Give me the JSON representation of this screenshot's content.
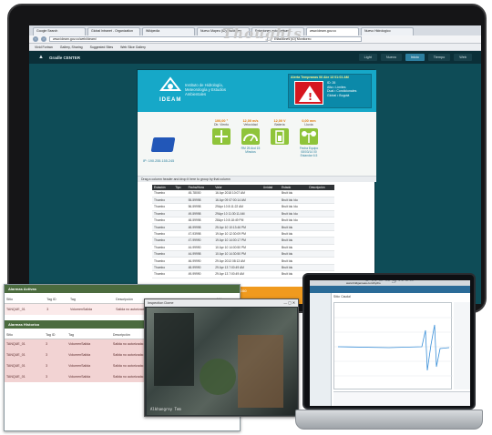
{
  "monitor": {
    "watermark": "Thoughts",
    "tabs": [
      "Google Search",
      "Global Intranet - Organization",
      "Wikipedia",
      "Nuevo Mapeo (ID) Monitoreo",
      "Estaciones automaticas",
      "www.ideam.gov.co",
      "Nuevo Hidrologico"
    ],
    "url": "www.ideam.gov.co/web/ideam/",
    "url2": "Estaciones (ID) Monitoreo",
    "bookmarks": [
      "Vivid Fortran",
      "Gallery, Sharing",
      "Suggested Sites",
      "Web Slice Gallery"
    ],
    "app": {
      "title": "Gradle CENTER",
      "nav": [
        "Light",
        "Nuevo",
        "Inicio",
        "Tiempo",
        "Web"
      ],
      "selected_nav": "Inicio"
    },
    "brand": {
      "org_text": "Instituto de Hidrología, Meteorología y Estudios Ambientales",
      "short": "IDEAM"
    },
    "alert": {
      "title": "Alerta Tempranas 06 Abr 13 01:01 AM",
      "lines": [
        "ID: 26",
        "Alta • Límites",
        "Dual • Condicionales",
        "Global • Bogotá"
      ]
    },
    "device_label": "IP: 190.255.155.245",
    "metrics": [
      {
        "value": "100,00 °",
        "label": "Dir. Viento",
        "sub": ""
      },
      {
        "value": "12,00 m/s",
        "label": "Velocidad",
        "sub": "RM 25 Avd 15 Minutos"
      },
      {
        "value": "12,00 V",
        "label": "Batería",
        "sub": ""
      },
      {
        "value": "0,00 mm",
        "label": "Lluvia",
        "sub": "Fecha Equipo 08/03/14 00 Estandar 6.5"
      }
    ],
    "table": {
      "title": "Drag a column header and drop it here to group by that column",
      "columns": [
        "Estación",
        "Tipo",
        "Fecha/Hora",
        "Valor",
        "Unidad",
        "Estado",
        "Descripción"
      ],
      "rows": [
        [
          "Thumbo",
          "",
          "45-78000",
          "16 Apr 2018 10:07 AM",
          "",
          "Bruit Idu",
          ""
        ],
        [
          "Thumbo",
          "",
          "55-59998",
          "16 Apr 09 07:00:14 AM",
          "",
          "Bruit Idu Idu",
          ""
        ],
        [
          "Thumbo",
          "",
          "56-59998",
          "29Apr 10 8:11:22 AM",
          "",
          "Bruit Idu Idu",
          ""
        ],
        [
          "Thumbo",
          "",
          "49-59998",
          "29Apr 10 11:30:11 AM",
          "",
          "Bruit Idu Idu",
          ""
        ],
        [
          "Thumbo",
          "",
          "48-59998",
          "28Apr 10 8:18:49 PM",
          "",
          "Bruit Idu Idu",
          ""
        ],
        [
          "Thumbo",
          "",
          "48-99998",
          "25 Apr 10 10:13:46 PM",
          "",
          "Bruit Idu",
          ""
        ],
        [
          "Thumbo",
          "",
          "47-93998",
          "19 Apr 10 12:30:09 PM",
          "",
          "Bruit Idu",
          ""
        ],
        [
          "Thumbo",
          "",
          "47-99990",
          "19 Apr 10 14:00:17 PM",
          "",
          "Bruit Idu",
          ""
        ],
        [
          "Thumbo",
          "",
          "44-99990",
          "10 Apr 10 14:00:50 PM",
          "",
          "Bruit Idu",
          ""
        ],
        [
          "Thumbo",
          "",
          "44-99998",
          "10 Apr 10 14:30:50 PM",
          "",
          "Bruit Idu",
          ""
        ],
        [
          "Thumbo",
          "",
          "46-99990",
          "29 Apr 2013 08:13 AM",
          "",
          "Bruit Idu",
          ""
        ],
        [
          "Thumbo",
          "",
          "48-99990",
          "29 Apr 13 7:00:49 AM",
          "",
          "Bruit Idu",
          ""
        ],
        [
          "Thumbo",
          "",
          "49-99990",
          "29 Apr 13 7:00:49 AM",
          "",
          "Bruit Idu",
          ""
        ]
      ]
    },
    "footer_text": [
      "Cll. 70 A # 11-36 Bogotá - Colombia   Tel: (+57) 3528360",
      "Línea gratuita: 01 8000 110012"
    ]
  },
  "alarms_window": {
    "title_active": "Alarmas Activas",
    "title_history": "Alarmas Historico",
    "columns": [
      "Sitio",
      "Tag ID",
      "Tag",
      "Descripción",
      "Valor"
    ],
    "active_rows": [
      [
        "TANQUE_01",
        "3",
        "VolumenSalida",
        "Salida no autorizada de combustible",
        "12,095"
      ]
    ],
    "history_rows": [
      [
        "TANQUE_01",
        "3",
        "VolumenSalida",
        "Salida no autorizada de combustible",
        "0,00007"
      ],
      [
        "TANQUE_01",
        "3",
        "VolumenSalida",
        "Salida no autorizada de combustible",
        "0,000003"
      ],
      [
        "TANQUE_01",
        "3",
        "VolumenSalida",
        "Salida no autorizada de combustible",
        "0,00001"
      ],
      [
        "TANQUE_01",
        "3",
        "VolumenSalida",
        "Salida no autorizada de combustible",
        "0,00001"
      ]
    ]
  },
  "camera_window": {
    "title": "Inspection Dome",
    "caption": "Alkhangrey Tem"
  },
  "laptop": {
    "url": "www.bridgemeas.com/hydro",
    "chart_title": "Sitio: Caudal"
  },
  "colors": {
    "screen_bg": "#0e4c57",
    "brand_blue": "#16a8c8",
    "alert_red": "#d6161f",
    "footer_orange": "#f09a1e",
    "metric_green": "#8fc43a"
  }
}
